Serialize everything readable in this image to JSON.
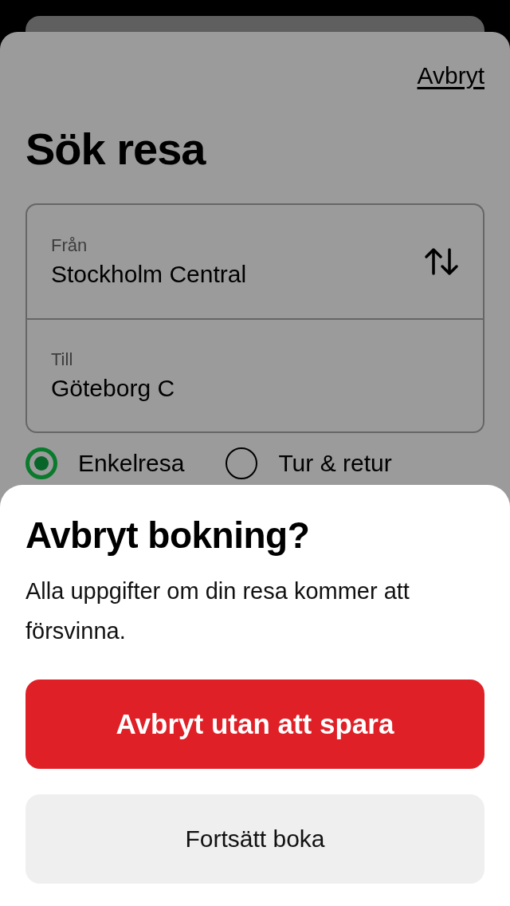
{
  "background_screen": {
    "cancel_link": "Avbryt",
    "title": "Sök resa",
    "from": {
      "label": "Från",
      "value": "Stockholm Central"
    },
    "to": {
      "label": "Till",
      "value": "Göteborg C"
    },
    "trip_types": [
      {
        "label": "Enkelresa",
        "selected": true
      },
      {
        "label": "Tur & retur",
        "selected": false
      }
    ]
  },
  "dialog": {
    "title": "Avbryt bokning?",
    "message": "Alla uppgifter om din resa kommer att försvinna.",
    "buttons": [
      {
        "label": "Avbryt utan att spara",
        "kind": "primary"
      },
      {
        "label": "Fortsätt boka",
        "kind": "secondary"
      }
    ]
  }
}
